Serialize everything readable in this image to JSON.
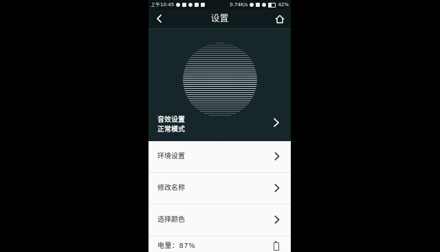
{
  "status_bar": {
    "time": "上午10:45",
    "speed": "0.74K/s",
    "battery_percent": "42%",
    "icons": [
      "chat-icon",
      "message-icon",
      "headphones-icon",
      "bug-icon",
      "video-icon",
      "alarm-icon",
      "signal-icon",
      "wifi-icon",
      "battery-icon"
    ]
  },
  "title_bar": {
    "title": "设置",
    "back_icon": "chevron-left-icon",
    "home_icon": "home-icon"
  },
  "sound_settings": {
    "label": "音效设置",
    "mode": "正常模式"
  },
  "menu": {
    "items": [
      {
        "label": "环境设置"
      },
      {
        "label": "修改名称"
      },
      {
        "label": "选择颜色"
      }
    ]
  },
  "battery": {
    "label": "电量：87%"
  },
  "colors": {
    "header_bg": "#0f1b1d",
    "hero_bg": "#132327",
    "list_bg": "#fafafa",
    "text_dark": "#333333"
  }
}
